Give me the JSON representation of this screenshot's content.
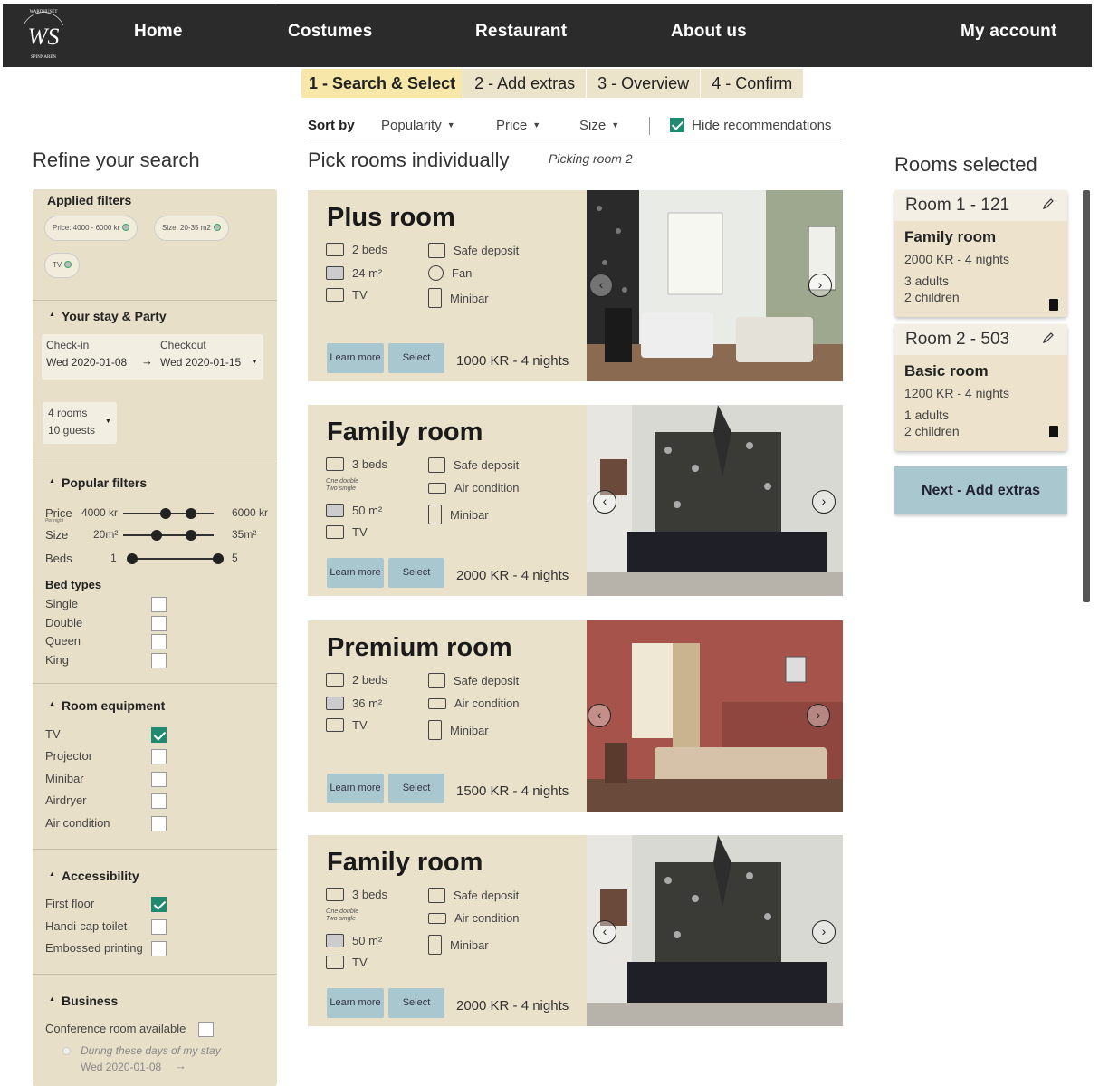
{
  "nav": {
    "logo_text": "WS",
    "logo_ring": "WARDHUSET SPINNAREN",
    "items": [
      "Home",
      "Costumes",
      "Restaurant",
      "About us"
    ],
    "account": "My account"
  },
  "steps": [
    {
      "label": "1 - Search & Select",
      "active": true
    },
    {
      "label": "2 - Add extras",
      "active": false
    },
    {
      "label": "3 - Overview",
      "active": false
    },
    {
      "label": "4 - Confirm",
      "active": false
    }
  ],
  "sort": {
    "label": "Sort by",
    "options": [
      "Popularity",
      "Price",
      "Size"
    ],
    "hide_recommendations": "Hide recommendations",
    "hide_checked": true
  },
  "headings": {
    "refine": "Refine your search",
    "pick": "Pick rooms individually",
    "picking": "Picking room 2",
    "selected": "Rooms selected"
  },
  "filters": {
    "applied_title": "Applied filters",
    "applied": [
      "Price: 4000 - 6000 kr",
      "Size: 20-35 m2",
      "TV"
    ],
    "stay": {
      "title": "Your stay & Party",
      "checkin_label": "Check-in",
      "checkout_label": "Checkout",
      "checkin": "Wed 2020-01-08",
      "checkout": "Wed 2020-01-15",
      "rooms": "4 rooms",
      "guests": "10 guests"
    },
    "popular": {
      "title": "Popular filters",
      "price_label": "Price",
      "price_sub": "Per night",
      "price_min": "4000 kr",
      "price_max": "6000 kr",
      "size_label": "Size",
      "size_min": "20m²",
      "size_max": "35m²",
      "beds_label": "Beds",
      "beds_min": "1",
      "beds_max": "5",
      "bed_types_title": "Bed types",
      "bed_types": [
        {
          "label": "Single",
          "checked": false
        },
        {
          "label": "Double",
          "checked": false
        },
        {
          "label": "Queen",
          "checked": false
        },
        {
          "label": "King",
          "checked": false
        }
      ]
    },
    "equipment": {
      "title": "Room equipment",
      "items": [
        {
          "label": "TV",
          "checked": true
        },
        {
          "label": "Projector",
          "checked": false
        },
        {
          "label": "Minibar",
          "checked": false
        },
        {
          "label": "Airdryer",
          "checked": false
        },
        {
          "label": "Air condition",
          "checked": false
        }
      ]
    },
    "accessibility": {
      "title": "Accessibility",
      "items": [
        {
          "label": "First floor",
          "checked": true
        },
        {
          "label": "Handi-cap toilet",
          "checked": false
        },
        {
          "label": "Embossed printing",
          "checked": false
        }
      ]
    },
    "business": {
      "title": "Business",
      "conference": "Conference room available",
      "during": "During these days of my stay",
      "date": "Wed 2020-01-08"
    }
  },
  "rooms": [
    {
      "title": "Plus room",
      "beds": "2 beds",
      "bed_sub": "",
      "size": "24 m²",
      "tv": "TV",
      "f1": "Safe deposit",
      "f2": "Fan",
      "f3": "Minibar",
      "learn": "Learn more",
      "select": "Select",
      "price": "1000 KR - 4 nights"
    },
    {
      "title": "Family room",
      "beds": "3 beds",
      "bed_sub": "One double\nTwo single",
      "size": "50 m²",
      "tv": "TV",
      "f1": "Safe deposit",
      "f2": "Air condition",
      "f3": "Minibar",
      "learn": "Learn more",
      "select": "Select",
      "price": "2000 KR - 4 nights"
    },
    {
      "title": "Premium room",
      "beds": "2 beds",
      "bed_sub": "",
      "size": "36 m²",
      "tv": "TV",
      "f1": "Safe deposit",
      "f2": "Air condition",
      "f3": "Minibar",
      "learn": "Learn more",
      "select": "Select",
      "price": "1500 KR - 4 nights"
    },
    {
      "title": "Family room",
      "beds": "3 beds",
      "bed_sub": "One double\nTwo single",
      "size": "50 m²",
      "tv": "TV",
      "f1": "Safe deposit",
      "f2": "Air condition",
      "f3": "Minibar",
      "learn": "Learn more",
      "select": "Select",
      "price": "2000 KR - 4 nights"
    }
  ],
  "selected": [
    {
      "header": "Room 1 - 121",
      "name": "Family room",
      "price": "2000 KR - 4 nights",
      "adults": "3 adults",
      "children": "2 children"
    },
    {
      "header": "Room 2 - 503",
      "name": "Basic room",
      "price": "1200 KR - 4 nights",
      "adults": "1 adults",
      "children": "2 children"
    }
  ],
  "next_button": "Next - Add extras",
  "colors": {
    "nav": "#2b2b2b",
    "panel": "#e8dfc8",
    "accent_button": "#a9c7cf",
    "check": "#1f8a6f",
    "active_step": "#f7e7a9"
  }
}
